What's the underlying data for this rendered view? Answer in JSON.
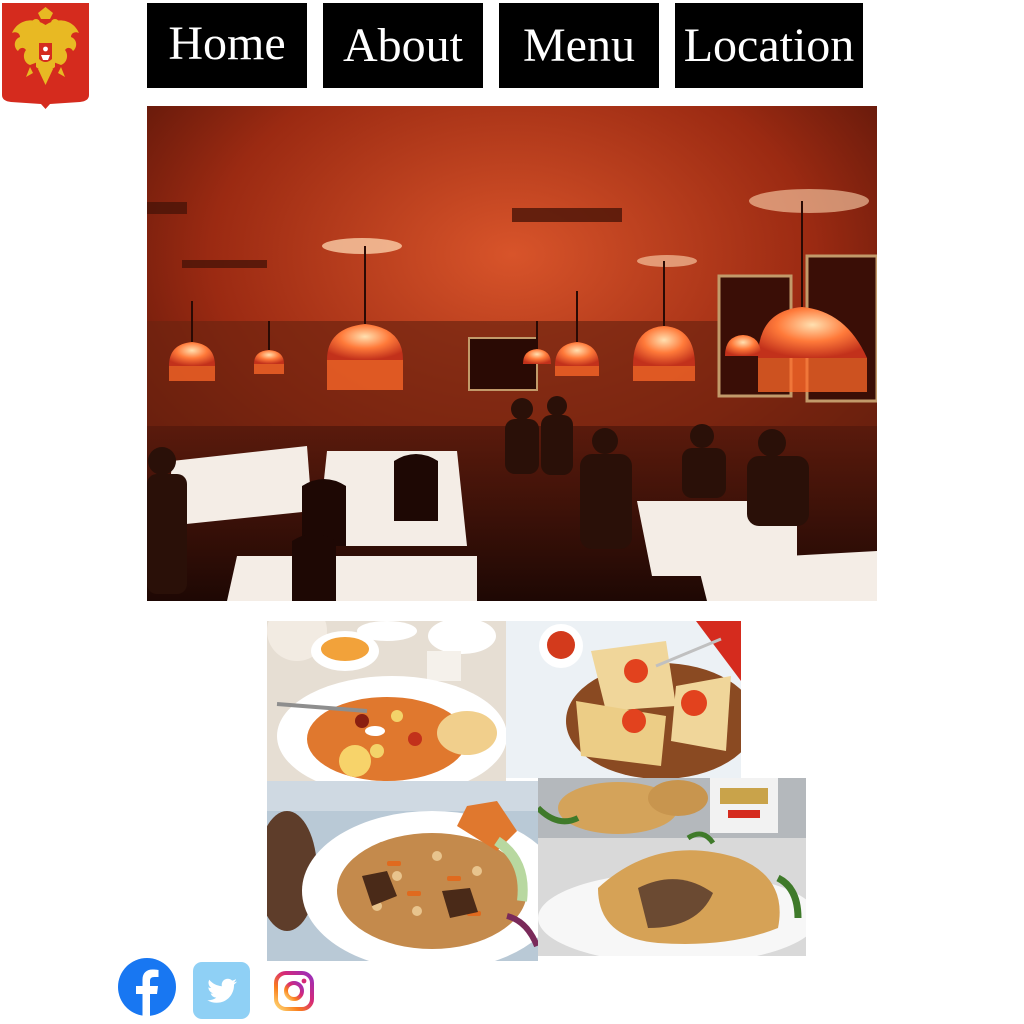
{
  "header": {
    "emblem_icon": "russian-coat-of-arms-icon"
  },
  "nav": {
    "items": [
      {
        "label": "Home"
      },
      {
        "label": "About"
      },
      {
        "label": "Menu"
      },
      {
        "label": "Location"
      }
    ]
  },
  "hero": {
    "image": "restaurant-dining-room-with-red-lamps"
  },
  "gallery": {
    "images": [
      "solyanka-soup",
      "blini-with-caviar",
      "plov-with-meat",
      "pirozhki-pastry"
    ]
  },
  "social": {
    "icons": [
      "facebook-icon",
      "twitter-icon",
      "instagram-icon"
    ],
    "colors": {
      "facebook": "#1877F2",
      "twitter": "#1DA1F2",
      "instagram": "#E1306C"
    }
  },
  "colors": {
    "nav_bg": "#000000",
    "nav_text": "#ffffff",
    "emblem_red": "#D52B1E",
    "emblem_gold": "#E8B923"
  }
}
